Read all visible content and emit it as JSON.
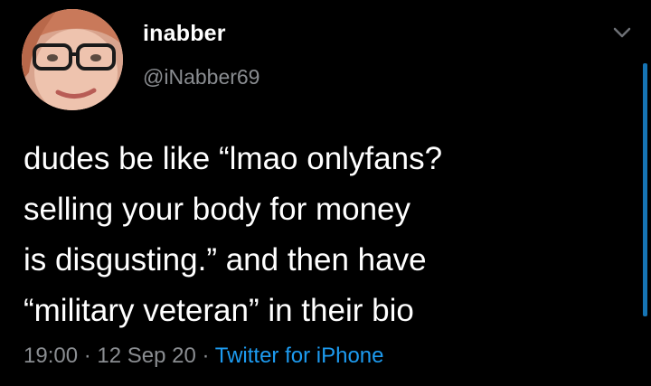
{
  "tweet": {
    "display_name": "inabber",
    "handle": "@iNabber69",
    "text": "dudes be like “lmao onlyfans?\nselling your body for money\nis disgusting.” and then have\n“military veteran” in their bio",
    "time": "19:00",
    "date": "12 Sep 20",
    "separator": "·",
    "source": "Twitter for iPhone"
  },
  "icons": {
    "avatar": "profile-photo",
    "chevron": "chevron-down-icon"
  },
  "colors": {
    "background": "#000000",
    "text": "#ffffff",
    "muted": "#8a8d91",
    "link": "#1d9bf0"
  }
}
